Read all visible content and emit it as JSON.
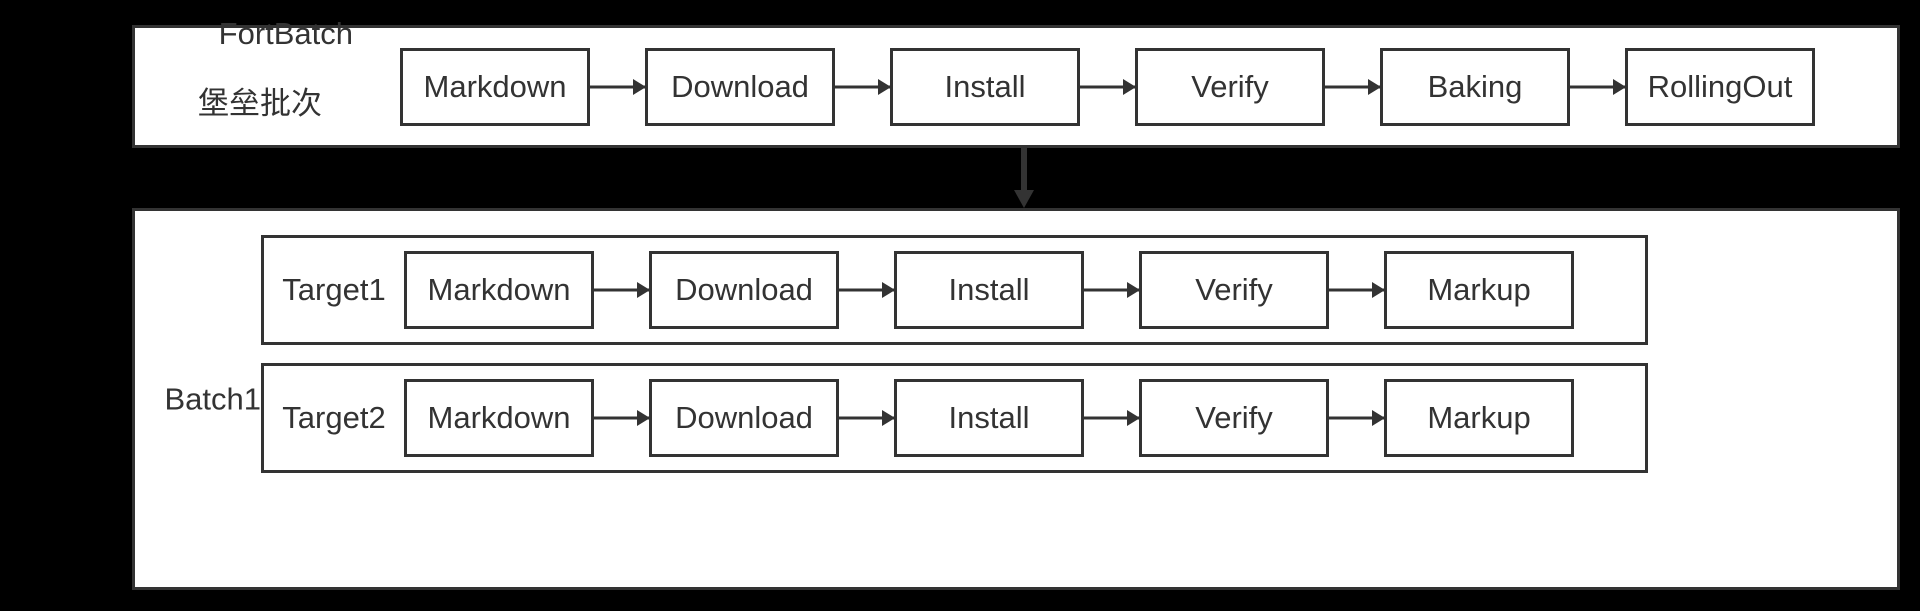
{
  "diagram": {
    "type": "flow-diagram",
    "colors": {
      "stroke": "#333333",
      "fill": "#ffffff",
      "background": "#000000"
    },
    "fortbatch": {
      "label_en": "FortBatch",
      "label_cn": "堡垒批次",
      "stages": [
        "Markdown",
        "Download",
        "Install",
        "Verify",
        "Baking",
        "RollingOut"
      ]
    },
    "batch": {
      "label": "Batch1",
      "targets": [
        {
          "label": "Target1",
          "stages": [
            "Markdown",
            "Download",
            "Install",
            "Verify",
            "Markup"
          ]
        },
        {
          "label": "Target2",
          "stages": [
            "Markdown",
            "Download",
            "Install",
            "Verify",
            "Markup"
          ]
        }
      ]
    },
    "connector": {
      "name": "downward-arrow",
      "direction": "down"
    }
  }
}
